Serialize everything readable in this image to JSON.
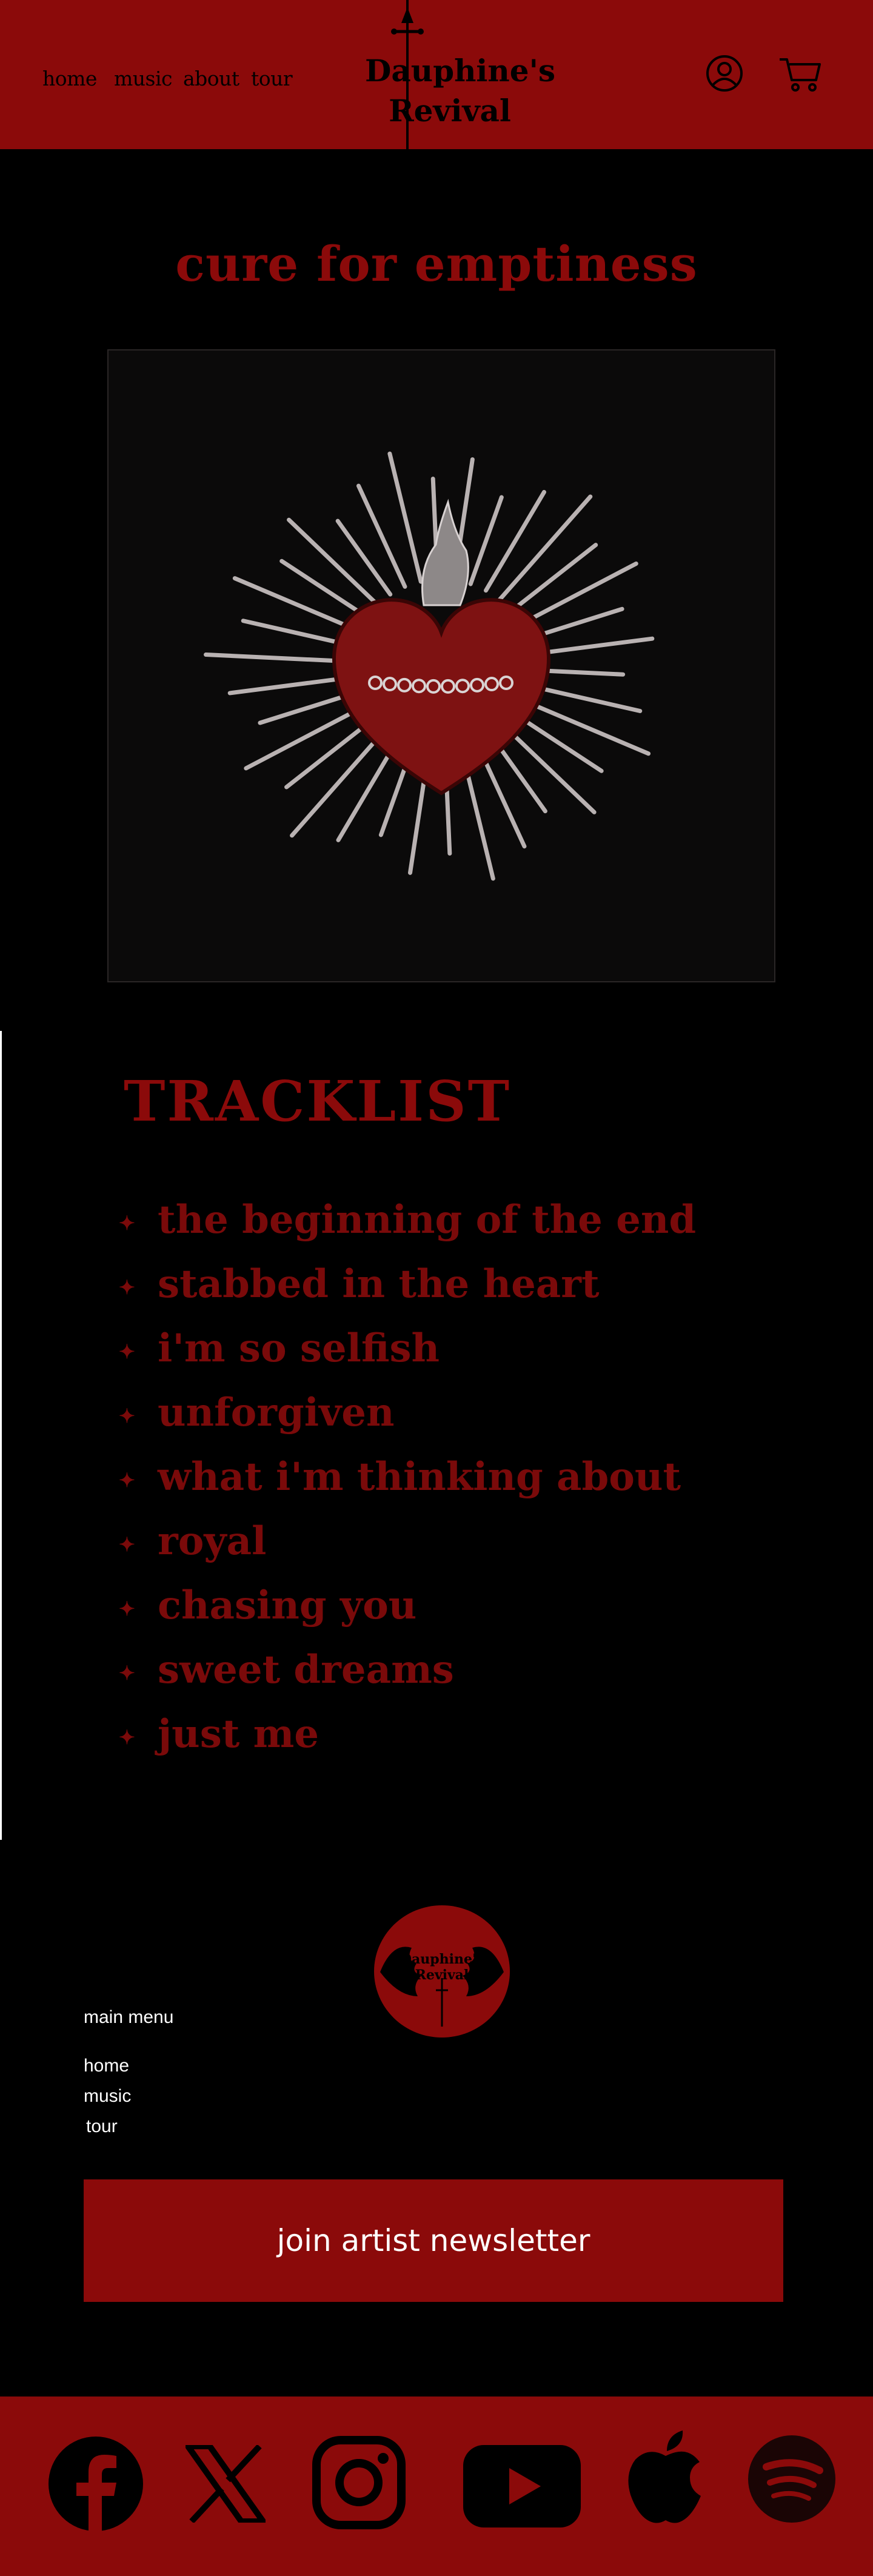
{
  "header": {
    "nav": [
      "home",
      "music",
      "about",
      "tour"
    ],
    "logo_line1": "Dauphine's",
    "logo_line2": "Revival",
    "account_icon": "user-circle-icon",
    "cart_icon": "shopping-cart-icon"
  },
  "album": {
    "title": "cure for emptiness",
    "cover_art": "sacred-heart-with-spikes"
  },
  "tracklist": {
    "heading": "TRACKLIST",
    "tracks": [
      "the beginning of the end",
      "stabbed in the heart",
      "i'm so selfish",
      "unforgiven",
      "what i'm thinking about",
      "royal",
      "chasing you",
      "sweet dreams",
      "just me"
    ]
  },
  "footer": {
    "logo_line1": "Dauphine's",
    "logo_line2": "Revival",
    "menu_heading": "main menu",
    "menu_links": [
      "home",
      "music",
      "tour"
    ],
    "newsletter_label": "join artist newsletter",
    "social": [
      "facebook-icon",
      "x-icon",
      "instagram-icon",
      "youtube-icon",
      "apple-music-icon",
      "spotify-icon"
    ]
  },
  "colors": {
    "brand_red": "#8b0a0a",
    "background": "#000000",
    "text_light": "#ffffff"
  }
}
